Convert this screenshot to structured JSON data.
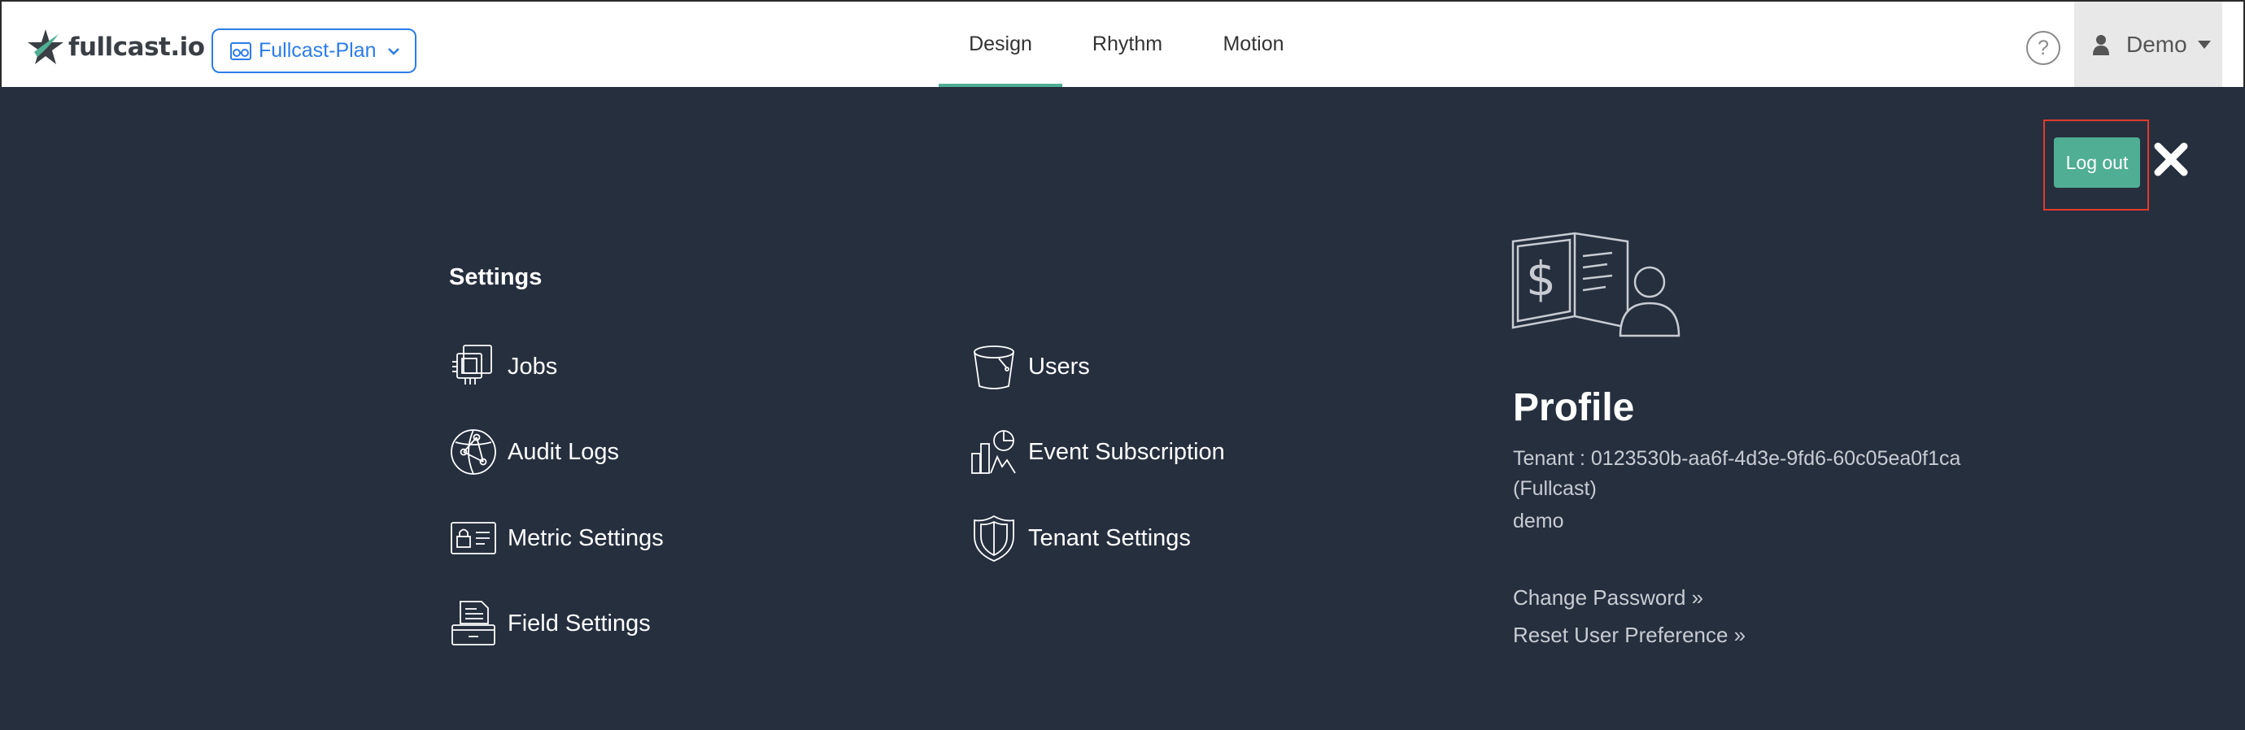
{
  "header": {
    "logo_text": "fullcast.io",
    "plan_selector": "Fullcast-Plan",
    "tabs": [
      {
        "label": "Design",
        "active": true
      },
      {
        "label": "Rhythm",
        "active": false
      },
      {
        "label": "Motion",
        "active": false
      }
    ],
    "help_glyph": "?",
    "user_name": "Demo"
  },
  "panel": {
    "logout_label": "Log out",
    "settings_title": "Settings",
    "menu_left": [
      {
        "label": "Jobs",
        "icon": "chip-icon"
      },
      {
        "label": "Audit Logs",
        "icon": "network-globe-icon"
      },
      {
        "label": "Metric Settings",
        "icon": "id-card-lock-icon"
      },
      {
        "label": "Field Settings",
        "icon": "file-drawer-icon"
      }
    ],
    "menu_right": [
      {
        "label": "Users",
        "icon": "bucket-icon"
      },
      {
        "label": "Event Subscription",
        "icon": "chart-buildings-icon"
      },
      {
        "label": "Tenant Settings",
        "icon": "shield-icon"
      }
    ],
    "profile": {
      "title": "Profile",
      "tenant_line1": "Tenant : 0123530b-aa6f-4d3e-9fd6-60c05ea0f1ca",
      "tenant_line2": "(Fullcast)",
      "username": "demo",
      "change_password": "Change Password »",
      "reset_preference": "Reset User Preference »"
    }
  },
  "colors": {
    "panel_bg": "#252f3e",
    "accent_green": "#4fae93",
    "accent_blue": "#2b7de9",
    "highlight_red": "#e23a2b"
  }
}
